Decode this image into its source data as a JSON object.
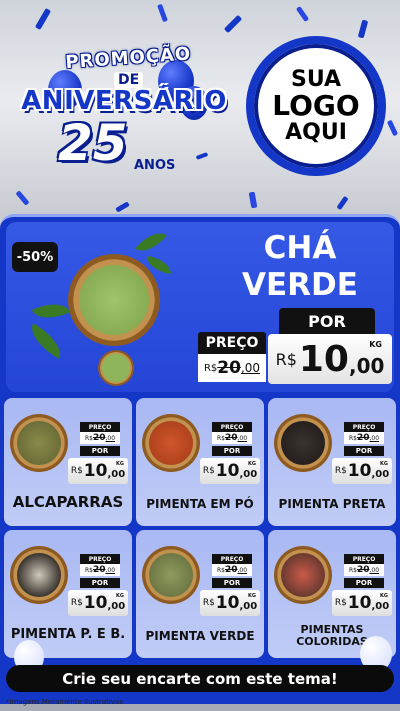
{
  "header": {
    "promo_word": "PROMOÇÃO",
    "de_word": "DE",
    "aniversario_word": "ANIVERSÁRIO",
    "number": "25",
    "anos_word": "ANOS",
    "logo_line1": "SUA",
    "logo_line2": "LOGO",
    "logo_line3": "AQUI"
  },
  "featured": {
    "discount": "-50%",
    "name_line1": "CHÁ",
    "name_line2": "VERDE",
    "por_label": "POR",
    "preco_label": "PREÇO",
    "old_currency": "R$",
    "old_int": "20",
    "old_dec": ",00",
    "new_currency": "R$",
    "new_int": "10",
    "new_dec": ",00",
    "unit": "KG"
  },
  "products": [
    {
      "name": "ALCAPARRAS",
      "preco_label": "PREÇO",
      "old_currency": "R$",
      "old_int": "20",
      "old_dec": ",00",
      "por_label": "POR",
      "currency": "R$",
      "int": "10",
      "dec": ",00",
      "unit": "KG"
    },
    {
      "name": "PIMENTA EM PÓ",
      "preco_label": "PREÇO",
      "old_currency": "R$",
      "old_int": "20",
      "old_dec": ",00",
      "por_label": "POR",
      "currency": "R$",
      "int": "10",
      "dec": ",00",
      "unit": "KG"
    },
    {
      "name": "PIMENTA PRETA",
      "preco_label": "PREÇO",
      "old_currency": "R$",
      "old_int": "20",
      "old_dec": ",00",
      "por_label": "POR",
      "currency": "R$",
      "int": "10",
      "dec": ",00",
      "unit": "KG"
    },
    {
      "name": "PIMENTA P. E B.",
      "preco_label": "PREÇO",
      "old_currency": "R$",
      "old_int": "20",
      "old_dec": ",00",
      "por_label": "POR",
      "currency": "R$",
      "int": "10",
      "dec": ",00",
      "unit": "KG"
    },
    {
      "name": "PIMENTA VERDE",
      "preco_label": "PREÇO",
      "old_currency": "R$",
      "old_int": "20",
      "old_dec": ",00",
      "por_label": "POR",
      "currency": "R$",
      "int": "10",
      "dec": ",00",
      "unit": "KG"
    },
    {
      "name_line1": "PIMENTAS",
      "name_line2": "COLORIDAS",
      "preco_label": "PREÇO",
      "old_currency": "R$",
      "old_int": "20",
      "old_dec": ",00",
      "por_label": "POR",
      "currency": "R$",
      "int": "10",
      "dec": ",00",
      "unit": "KG"
    }
  ],
  "footer": {
    "cta": "Crie seu encarte com este tema!",
    "disclaimer": "*Imagens Meramente Ilustrativas"
  },
  "colors": {
    "brand_blue": "#1537c8",
    "card_bg": "#b6c3f5",
    "tag_black": "#111111"
  }
}
